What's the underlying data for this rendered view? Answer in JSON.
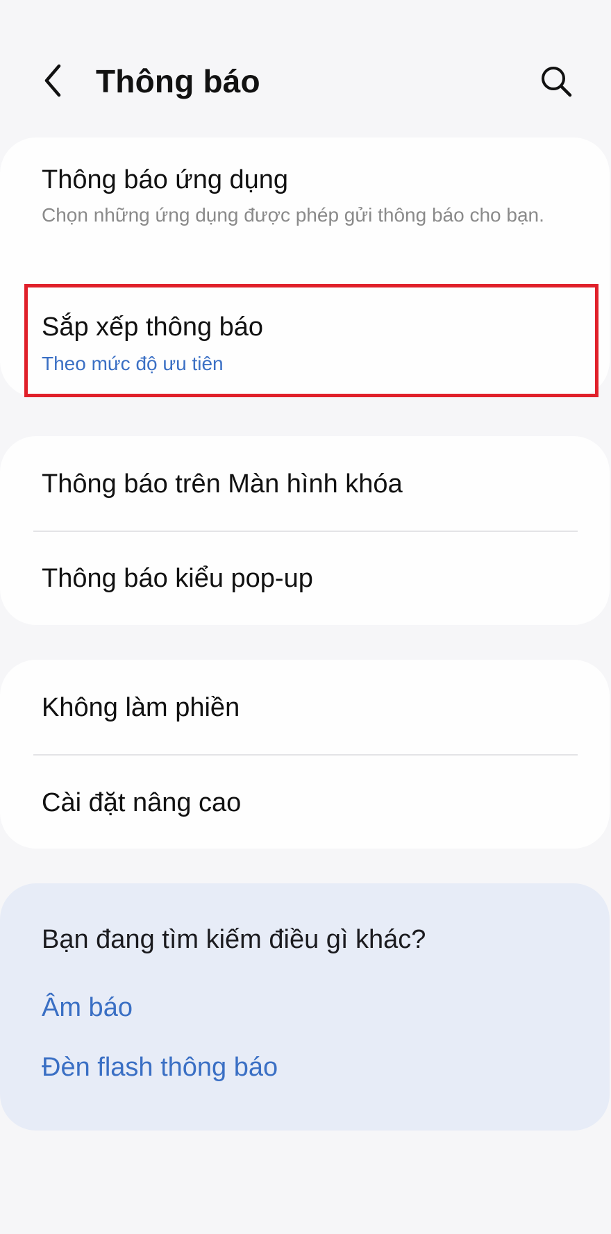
{
  "header": {
    "title": "Thông báo",
    "back_icon": "back-arrow-icon",
    "search_icon": "search-icon"
  },
  "group1": {
    "app_notifications": {
      "title": "Thông báo ứng dụng",
      "subtitle": "Chọn những ứng dụng được phép gửi thông báo cho bạn."
    },
    "sort_notifications": {
      "title": "Sắp xếp thông báo",
      "value": "Theo mức độ ưu tiên"
    }
  },
  "group2": {
    "items": [
      {
        "title": "Thông báo trên Màn hình khóa"
      },
      {
        "title": "Thông báo kiểu pop-up"
      }
    ]
  },
  "group3": {
    "items": [
      {
        "title": "Không làm phiền"
      },
      {
        "title": "Cài đặt nâng cao"
      }
    ]
  },
  "suggestions": {
    "title": "Bạn đang tìm kiếm điều gì khác?",
    "links": [
      {
        "label": "Âm báo"
      },
      {
        "label": "Đèn flash thông báo"
      }
    ]
  },
  "colors": {
    "background": "#f6f6f8",
    "card": "#fefefe",
    "suggest_card": "#e7ecf7",
    "accent_blue": "#3a6fc4",
    "highlight_red": "#e0202a"
  }
}
